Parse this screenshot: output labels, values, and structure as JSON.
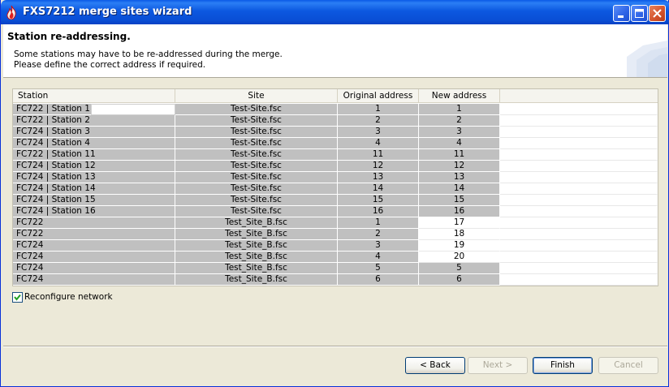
{
  "window": {
    "title": "FXS7212 merge sites wizard"
  },
  "header": {
    "title": "Station re-addressing.",
    "desc_line1": "Some stations may have to be re-addressed during the merge.",
    "desc_line2": "Please define the correct address if required."
  },
  "table": {
    "columns": [
      "Station",
      "Site",
      "Original address",
      "New address"
    ],
    "rows": [
      {
        "station": "FC722 | Station 1",
        "site": "Test-Site.fsc",
        "original": "1",
        "new": "1"
      },
      {
        "station": "FC722 | Station 2",
        "site": "Test-Site.fsc",
        "original": "2",
        "new": "2"
      },
      {
        "station": "FC724 | Station 3",
        "site": "Test-Site.fsc",
        "original": "3",
        "new": "3"
      },
      {
        "station": "FC724 | Station 4",
        "site": "Test-Site.fsc",
        "original": "4",
        "new": "4"
      },
      {
        "station": "FC722 | Station 11",
        "site": "Test-Site.fsc",
        "original": "11",
        "new": "11"
      },
      {
        "station": "FC724 | Station 12",
        "site": "Test-Site.fsc",
        "original": "12",
        "new": "12"
      },
      {
        "station": "FC724 | Station 13",
        "site": "Test-Site.fsc",
        "original": "13",
        "new": "13"
      },
      {
        "station": "FC724 | Station 14",
        "site": "Test-Site.fsc",
        "original": "14",
        "new": "14"
      },
      {
        "station": "FC724 | Station 15",
        "site": "Test-Site.fsc",
        "original": "15",
        "new": "15"
      },
      {
        "station": "FC724 | Station 16",
        "site": "Test-Site.fsc",
        "original": "16",
        "new": "16"
      },
      {
        "station": "FC722",
        "site": "Test_Site_B.fsc",
        "original": "1",
        "new": "17"
      },
      {
        "station": "FC722",
        "site": "Test_Site_B.fsc",
        "original": "2",
        "new": "18"
      },
      {
        "station": "FC724",
        "site": "Test_Site_B.fsc",
        "original": "3",
        "new": "19"
      },
      {
        "station": "FC724",
        "site": "Test_Site_B.fsc",
        "original": "4",
        "new": "20"
      },
      {
        "station": "FC724",
        "site": "Test_Site_B.fsc",
        "original": "5",
        "new": "5"
      },
      {
        "station": "FC724",
        "site": "Test_Site_B.fsc",
        "original": "6",
        "new": "6"
      }
    ]
  },
  "options": {
    "reconfigure_label": "Reconfigure network",
    "reconfigure_checked": true
  },
  "buttons": {
    "back": "< Back",
    "next": "Next >",
    "finish": "Finish",
    "cancel": "Cancel"
  },
  "icons": {
    "app": "flame-icon",
    "minimize": "minimize-icon",
    "maximize": "maximize-icon",
    "close": "close-icon",
    "check": "checkmark-icon"
  },
  "colors": {
    "titlebar": "#0a4fd6",
    "locked_cell": "#c0c0c0",
    "edit_cell": "#ffffff"
  }
}
